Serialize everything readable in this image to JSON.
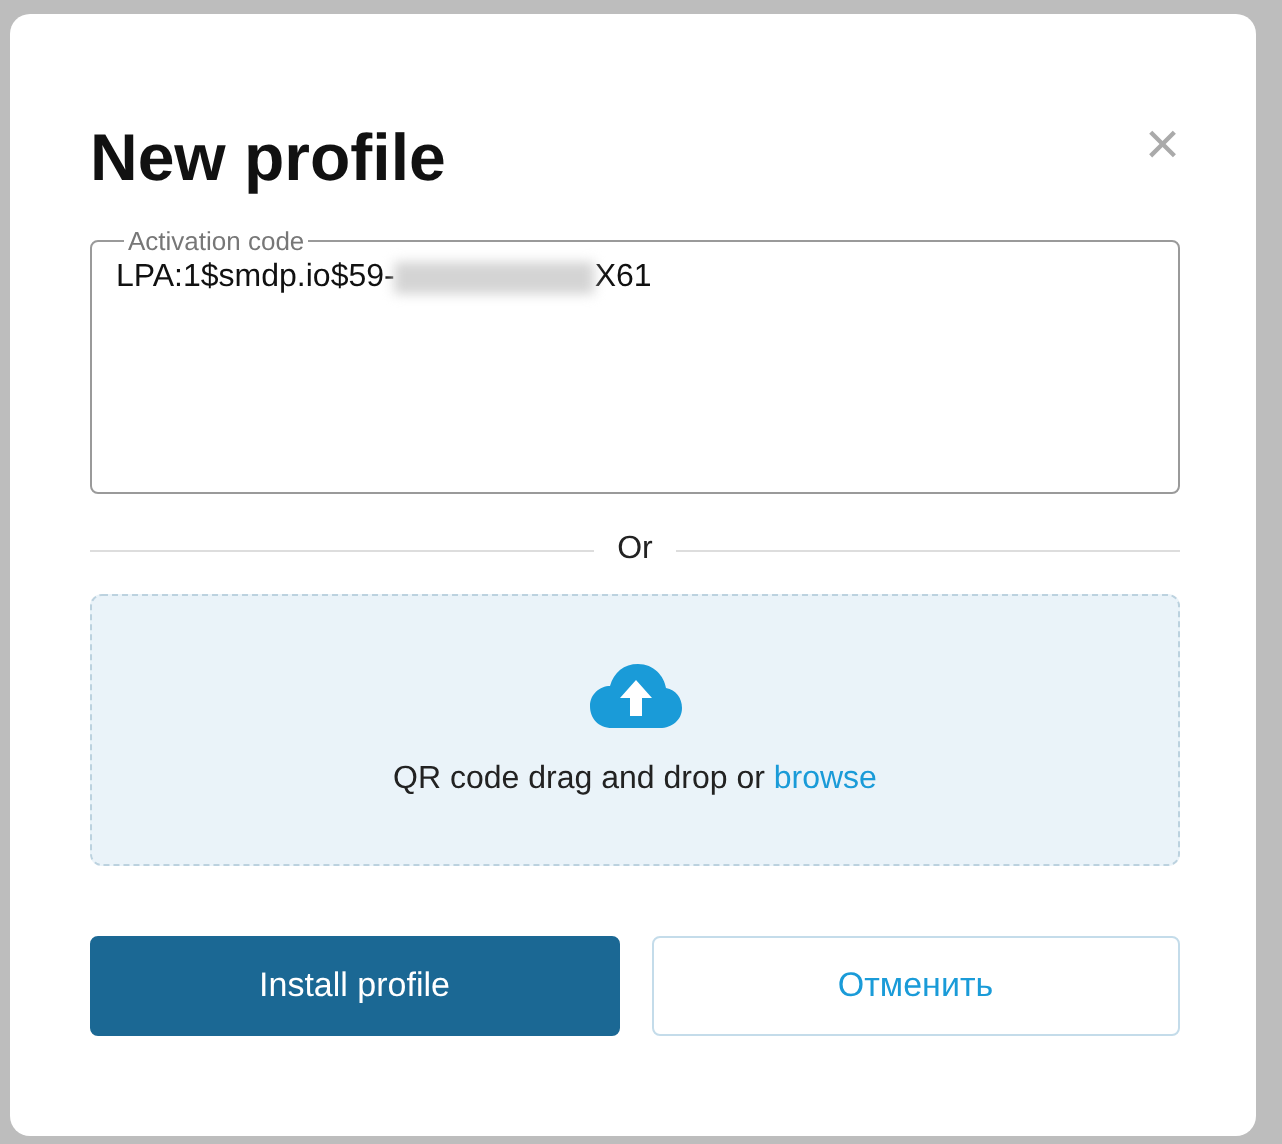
{
  "dialog": {
    "title": "New profile",
    "close": "×",
    "activation_code": {
      "label": "Activation code",
      "value_start": "LPA:1$smdp.io$59-",
      "redacted": true,
      "value_end": "X61"
    },
    "divider": "Or",
    "dropzone": {
      "text": "QR code drag and drop or ",
      "link": "browse"
    },
    "buttons": [
      {
        "kind": "primary",
        "label": "Install profile"
      },
      {
        "kind": "secondary",
        "label": "Отменить"
      }
    ]
  }
}
